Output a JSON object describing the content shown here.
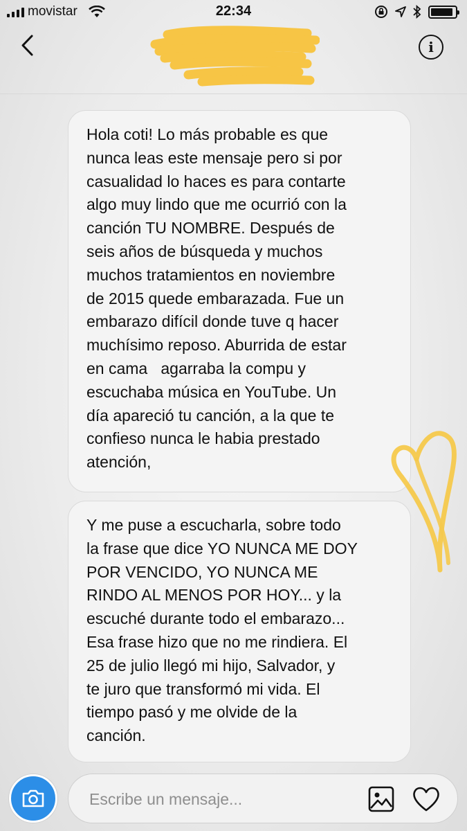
{
  "status_bar": {
    "carrier": "movistar",
    "time": "22:34",
    "battery_level": 0.92,
    "icons": [
      "signal-icon",
      "wifi-icon",
      "rotation-lock-icon",
      "location-icon",
      "bluetooth-icon",
      "battery-icon"
    ]
  },
  "header": {
    "back_icon": "chevron-left-icon",
    "info_icon": "info-icon",
    "info_glyph": "i"
  },
  "messages": [
    {
      "lines": [
        "Hola coti! Lo más probable es que",
        "nunca leas este mensaje pero si por",
        "casualidad lo haces es para contarte",
        "algo muy lindo que me ocurrió con la",
        "canción TU NOMBRE. Después de",
        "seis años de búsqueda y muchos",
        "muchos tratamientos en noviembre",
        "de 2015 quede embarazada. Fue un",
        "embarazo difícil donde tuve q hacer",
        "muchísimo reposo. Aburrida de estar",
        "en cama   agarraba la compu y",
        "escuchaba música en YouTube. Un",
        "día apareció tu canción, a la que te",
        "confieso nunca le habia prestado",
        "atención,"
      ]
    },
    {
      "lines": [
        "Y me puse a escucharla, sobre todo",
        "la frase que dice YO NUNCA ME DOY",
        "POR VENCIDO, YO NUNCA ME",
        "RINDO AL MENOS POR HOY... y la",
        "escuché durante todo el embarazo...",
        "Esa frase hizo que no me rindiera. El",
        "25 de julio llegó mi hijo, Salvador, y",
        "te juro que transformó mi vida. El",
        "tiempo pasó y me olvide de la",
        "canción."
      ]
    }
  ],
  "composer": {
    "placeholder": "Escribe un mensaje...",
    "camera_icon": "camera-icon",
    "photo_icon": "image-icon",
    "like_icon": "heart-icon"
  },
  "colors": {
    "accent": "#2c8ee7",
    "highlighter": "#f7c545",
    "bubble_bg": "#f4f4f4"
  }
}
